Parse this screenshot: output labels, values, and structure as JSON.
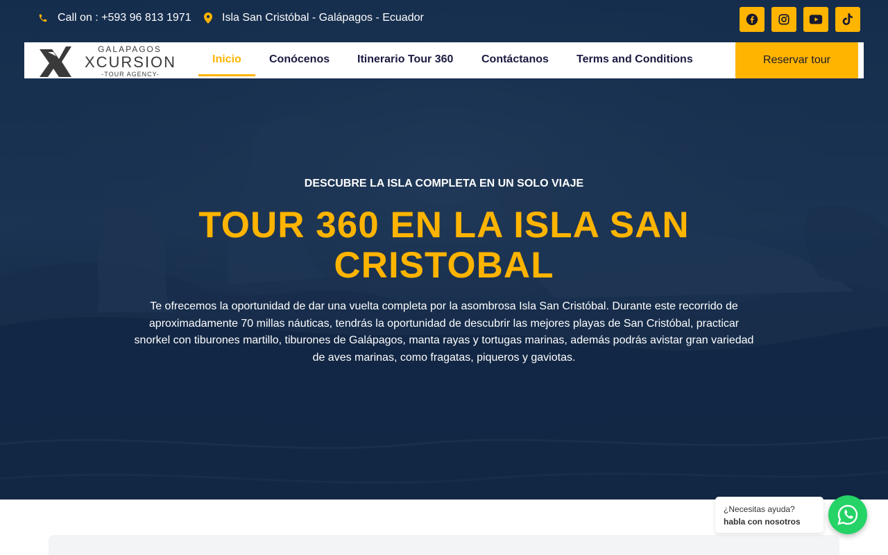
{
  "colors": {
    "accent": "#FFB400",
    "nav_text": "#1a1a40",
    "whatsapp": "#25D366"
  },
  "topbar": {
    "phone": "Call on : +593 96 813 1971",
    "location": "Isla San Cristóbal - Galápagos - Ecuador",
    "social": [
      "facebook-icon",
      "instagram-icon",
      "youtube-icon",
      "tiktok-icon"
    ]
  },
  "logo": {
    "top": "GALAPAGOS",
    "main": "XCURSION",
    "sub": "-TOUR AGENCY-"
  },
  "nav": {
    "items": [
      {
        "label": "Inicio",
        "active": true
      },
      {
        "label": "Conócenos"
      },
      {
        "label": "Itinerario Tour 360"
      },
      {
        "label": "Contáctanos"
      },
      {
        "label": "Terms and Conditions"
      }
    ],
    "cta": "Reservar tour"
  },
  "hero": {
    "eyebrow": "DESCUBRE LA ISLA COMPLETA EN UN SOLO VIAJE",
    "title": "TOUR 360 EN LA ISLA SAN CRISTOBAL",
    "description": "Te ofrecemos la oportunidad de dar una vuelta completa por la asombrosa Isla San Cristóbal. Durante este recorrido de aproximadamente 70 millas náuticas, tendrás la oportunidad de descubrir las mejores playas de San Cristóbal, practicar snorkel con tiburones martillo, tiburones de Galápagos, manta rayas y tortugas marinas, además podrás avistar gran variedad de aves marinas, como fragatas, piqueros y gaviotas."
  },
  "chat": {
    "prefix": "¿Necesitas ayuda?",
    "bold": "habla con nosotros"
  }
}
